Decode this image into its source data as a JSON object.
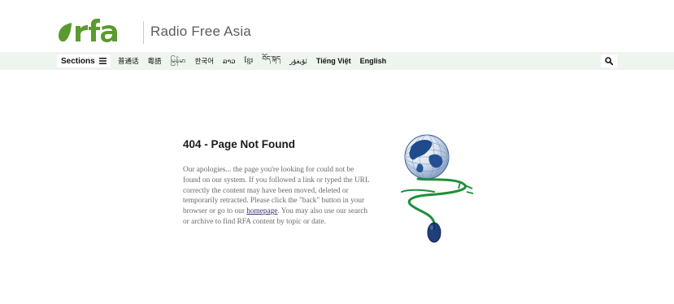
{
  "header": {
    "logo_text": "rfa",
    "tagline": "Radio Free Asia",
    "brand_color": "#5a9a2f"
  },
  "nav": {
    "sections_label": "Sections",
    "sections_icon": "hamburger-menu-icon",
    "languages": [
      {
        "label": "普通话",
        "bold": false
      },
      {
        "label": "粵語",
        "bold": false
      },
      {
        "label": "မြန်မာ",
        "bold": false
      },
      {
        "label": "한국어",
        "bold": false
      },
      {
        "label": "ລາວ",
        "bold": false
      },
      {
        "label": "ខ្មែរ",
        "bold": false
      },
      {
        "label": "བོད་སྐད",
        "bold": false
      },
      {
        "label": "ئۇيغۇر",
        "bold": false
      },
      {
        "label": "Tiếng Việt",
        "bold": true
      },
      {
        "label": "English",
        "bold": true
      }
    ],
    "search_icon": "search-icon"
  },
  "error": {
    "title": "404 - Page Not Found",
    "message_before_link": "Our apologies... the page you're looking for could not be found on our system. If you followed a link or typed the URL correctly the content may have been moved, deleted or temporarily retracted. Please click the \"back\" button in your browser or go to our ",
    "link_text": "homepage",
    "message_after_link": ". You may also use our search or archive to find RFA content by topic or date."
  },
  "illustration": {
    "icon": "globe-mouse-icon"
  }
}
